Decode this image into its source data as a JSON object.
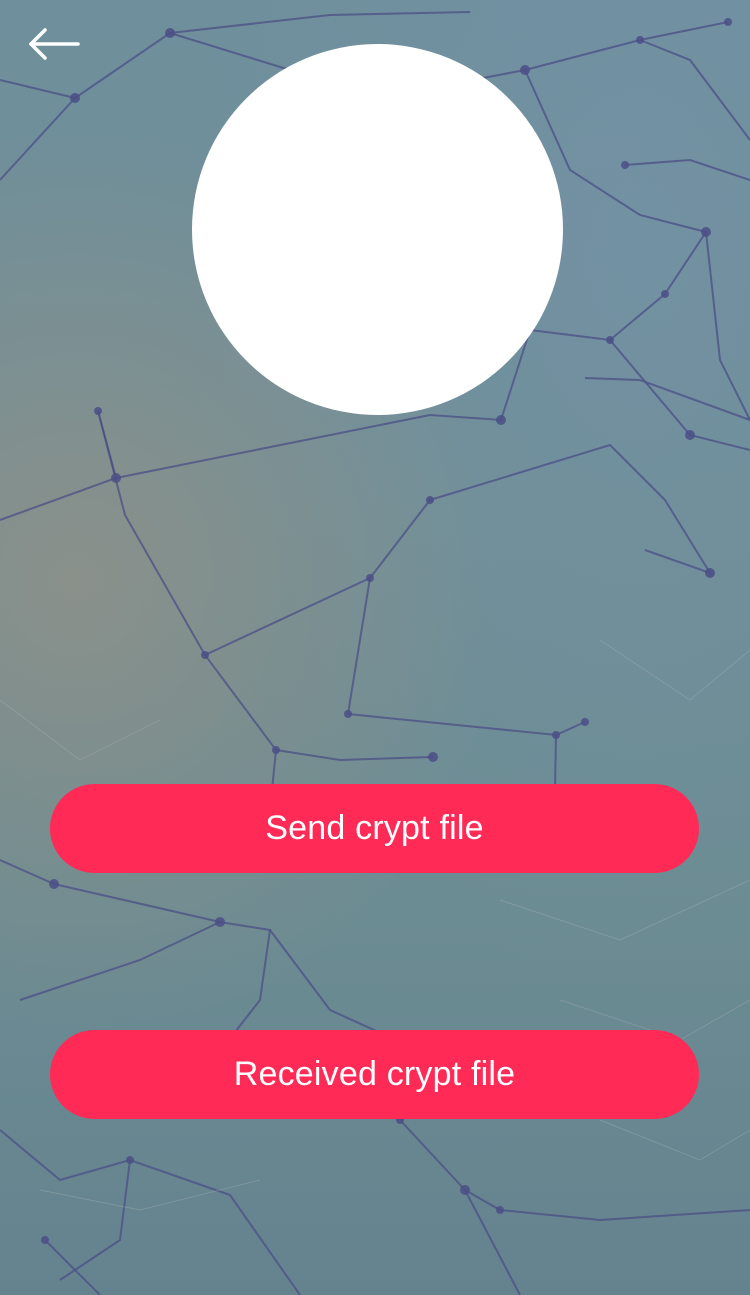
{
  "header": {
    "back_icon": "arrow-left-icon"
  },
  "profile": {
    "avatar": "avatar-placeholder"
  },
  "actions": {
    "send_label": "Send crypt file",
    "received_label": "Received crypt file"
  },
  "colors": {
    "button": "#ff2a55",
    "button_text": "#ffffff",
    "avatar": "#ffffff",
    "background": "#6f8e95",
    "network_lines": "#4b4f86"
  }
}
